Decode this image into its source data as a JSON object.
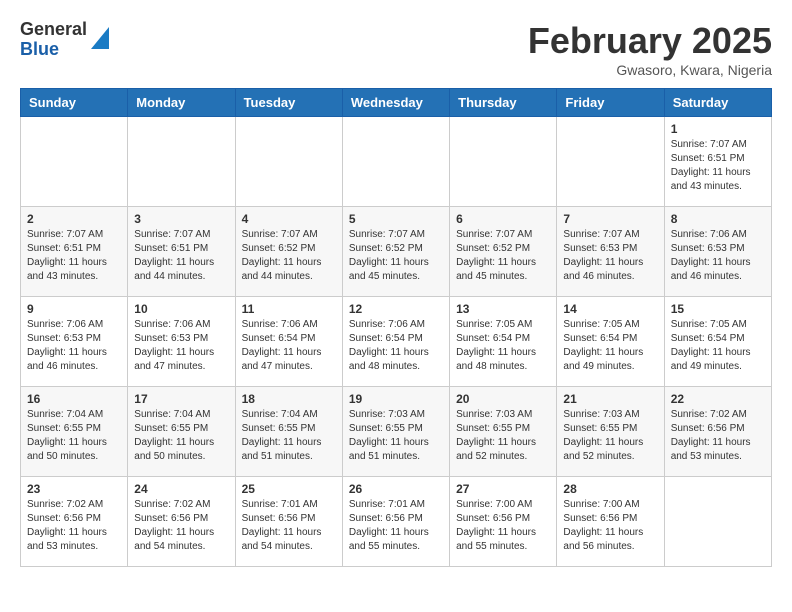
{
  "header": {
    "logo_general": "General",
    "logo_blue": "Blue",
    "month_title": "February 2025",
    "location": "Gwasoro, Kwara, Nigeria"
  },
  "calendar": {
    "days_of_week": [
      "Sunday",
      "Monday",
      "Tuesday",
      "Wednesday",
      "Thursday",
      "Friday",
      "Saturday"
    ],
    "weeks": [
      [
        {
          "day": "",
          "info": ""
        },
        {
          "day": "",
          "info": ""
        },
        {
          "day": "",
          "info": ""
        },
        {
          "day": "",
          "info": ""
        },
        {
          "day": "",
          "info": ""
        },
        {
          "day": "",
          "info": ""
        },
        {
          "day": "1",
          "info": "Sunrise: 7:07 AM\nSunset: 6:51 PM\nDaylight: 11 hours\nand 43 minutes."
        }
      ],
      [
        {
          "day": "2",
          "info": "Sunrise: 7:07 AM\nSunset: 6:51 PM\nDaylight: 11 hours\nand 43 minutes."
        },
        {
          "day": "3",
          "info": "Sunrise: 7:07 AM\nSunset: 6:51 PM\nDaylight: 11 hours\nand 44 minutes."
        },
        {
          "day": "4",
          "info": "Sunrise: 7:07 AM\nSunset: 6:52 PM\nDaylight: 11 hours\nand 44 minutes."
        },
        {
          "day": "5",
          "info": "Sunrise: 7:07 AM\nSunset: 6:52 PM\nDaylight: 11 hours\nand 45 minutes."
        },
        {
          "day": "6",
          "info": "Sunrise: 7:07 AM\nSunset: 6:52 PM\nDaylight: 11 hours\nand 45 minutes."
        },
        {
          "day": "7",
          "info": "Sunrise: 7:07 AM\nSunset: 6:53 PM\nDaylight: 11 hours\nand 46 minutes."
        },
        {
          "day": "8",
          "info": "Sunrise: 7:06 AM\nSunset: 6:53 PM\nDaylight: 11 hours\nand 46 minutes."
        }
      ],
      [
        {
          "day": "9",
          "info": "Sunrise: 7:06 AM\nSunset: 6:53 PM\nDaylight: 11 hours\nand 46 minutes."
        },
        {
          "day": "10",
          "info": "Sunrise: 7:06 AM\nSunset: 6:53 PM\nDaylight: 11 hours\nand 47 minutes."
        },
        {
          "day": "11",
          "info": "Sunrise: 7:06 AM\nSunset: 6:54 PM\nDaylight: 11 hours\nand 47 minutes."
        },
        {
          "day": "12",
          "info": "Sunrise: 7:06 AM\nSunset: 6:54 PM\nDaylight: 11 hours\nand 48 minutes."
        },
        {
          "day": "13",
          "info": "Sunrise: 7:05 AM\nSunset: 6:54 PM\nDaylight: 11 hours\nand 48 minutes."
        },
        {
          "day": "14",
          "info": "Sunrise: 7:05 AM\nSunset: 6:54 PM\nDaylight: 11 hours\nand 49 minutes."
        },
        {
          "day": "15",
          "info": "Sunrise: 7:05 AM\nSunset: 6:54 PM\nDaylight: 11 hours\nand 49 minutes."
        }
      ],
      [
        {
          "day": "16",
          "info": "Sunrise: 7:04 AM\nSunset: 6:55 PM\nDaylight: 11 hours\nand 50 minutes."
        },
        {
          "day": "17",
          "info": "Sunrise: 7:04 AM\nSunset: 6:55 PM\nDaylight: 11 hours\nand 50 minutes."
        },
        {
          "day": "18",
          "info": "Sunrise: 7:04 AM\nSunset: 6:55 PM\nDaylight: 11 hours\nand 51 minutes."
        },
        {
          "day": "19",
          "info": "Sunrise: 7:03 AM\nSunset: 6:55 PM\nDaylight: 11 hours\nand 51 minutes."
        },
        {
          "day": "20",
          "info": "Sunrise: 7:03 AM\nSunset: 6:55 PM\nDaylight: 11 hours\nand 52 minutes."
        },
        {
          "day": "21",
          "info": "Sunrise: 7:03 AM\nSunset: 6:55 PM\nDaylight: 11 hours\nand 52 minutes."
        },
        {
          "day": "22",
          "info": "Sunrise: 7:02 AM\nSunset: 6:56 PM\nDaylight: 11 hours\nand 53 minutes."
        }
      ],
      [
        {
          "day": "23",
          "info": "Sunrise: 7:02 AM\nSunset: 6:56 PM\nDaylight: 11 hours\nand 53 minutes."
        },
        {
          "day": "24",
          "info": "Sunrise: 7:02 AM\nSunset: 6:56 PM\nDaylight: 11 hours\nand 54 minutes."
        },
        {
          "day": "25",
          "info": "Sunrise: 7:01 AM\nSunset: 6:56 PM\nDaylight: 11 hours\nand 54 minutes."
        },
        {
          "day": "26",
          "info": "Sunrise: 7:01 AM\nSunset: 6:56 PM\nDaylight: 11 hours\nand 55 minutes."
        },
        {
          "day": "27",
          "info": "Sunrise: 7:00 AM\nSunset: 6:56 PM\nDaylight: 11 hours\nand 55 minutes."
        },
        {
          "day": "28",
          "info": "Sunrise: 7:00 AM\nSunset: 6:56 PM\nDaylight: 11 hours\nand 56 minutes."
        },
        {
          "day": "",
          "info": ""
        }
      ]
    ]
  }
}
